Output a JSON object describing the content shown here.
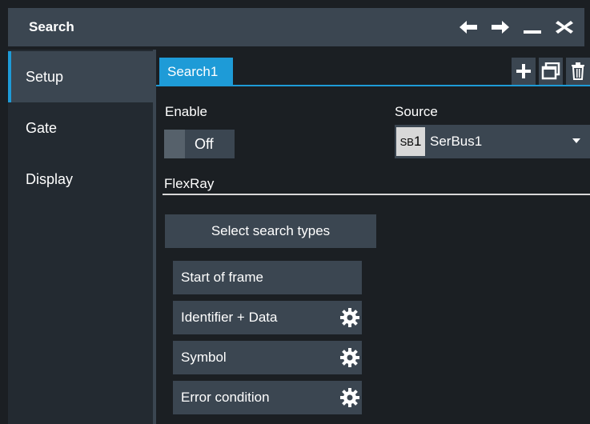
{
  "window": {
    "title": "Search",
    "icons": [
      "arrow-left-icon",
      "arrow-right-icon",
      "minimize-icon",
      "close-icon"
    ]
  },
  "sidebar": {
    "items": [
      {
        "label": "Setup",
        "active": true
      },
      {
        "label": "Gate",
        "active": false
      },
      {
        "label": "Display",
        "active": false
      }
    ]
  },
  "tabs": {
    "items": [
      {
        "label": "Search1"
      }
    ],
    "actions": [
      "add-icon",
      "copy-icon",
      "delete-icon"
    ]
  },
  "enable": {
    "label": "Enable",
    "value": "Off"
  },
  "source": {
    "label": "Source",
    "badge_prefix": "SB",
    "badge_number": "1",
    "value": "SerBus1"
  },
  "section": {
    "title": "FlexRay"
  },
  "search_types": {
    "button_label": "Select search types",
    "items": [
      {
        "label": "Start of frame",
        "has_settings": false
      },
      {
        "label": "Identifier + Data",
        "has_settings": true
      },
      {
        "label": "Symbol",
        "has_settings": true
      },
      {
        "label": "Error condition",
        "has_settings": true
      }
    ]
  },
  "colors": {
    "accent": "#1e9bd7",
    "panel": "#3b4651",
    "background": "#1b1f23"
  }
}
